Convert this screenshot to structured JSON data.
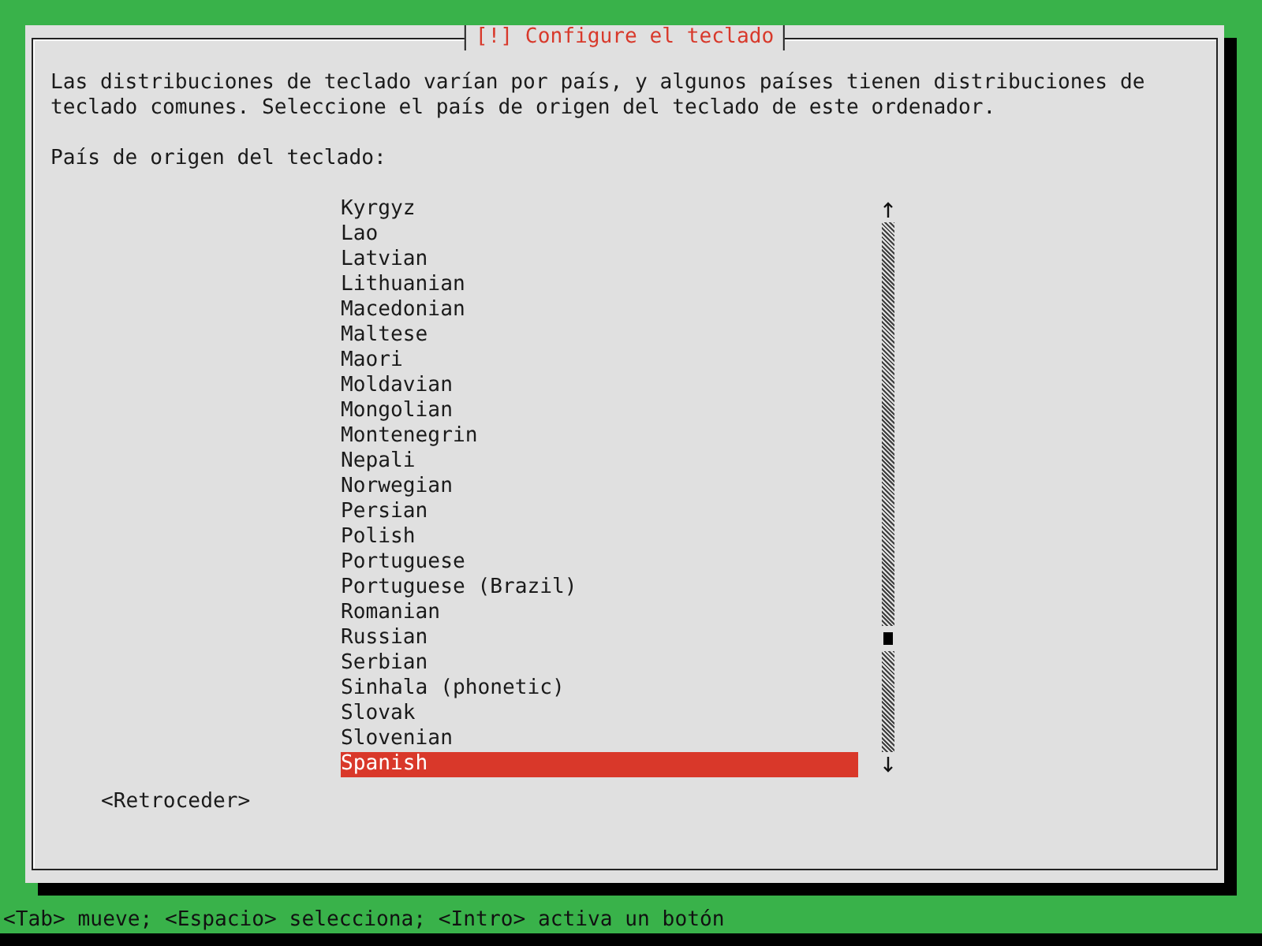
{
  "dialog": {
    "title": "[!] Configure el teclado",
    "description": "Las distribuciones de teclado varían por país, y algunos países tienen distribuciones de teclado comunes. Seleccione el país de origen del teclado de este ordenador.",
    "list_label": "País de origen del teclado:",
    "items": [
      {
        "label": "Kyrgyz",
        "selected": false
      },
      {
        "label": "Lao",
        "selected": false
      },
      {
        "label": "Latvian",
        "selected": false
      },
      {
        "label": "Lithuanian",
        "selected": false
      },
      {
        "label": "Macedonian",
        "selected": false
      },
      {
        "label": "Maltese",
        "selected": false
      },
      {
        "label": "Maori",
        "selected": false
      },
      {
        "label": "Moldavian",
        "selected": false
      },
      {
        "label": "Mongolian",
        "selected": false
      },
      {
        "label": "Montenegrin",
        "selected": false
      },
      {
        "label": "Nepali",
        "selected": false
      },
      {
        "label": "Norwegian",
        "selected": false
      },
      {
        "label": "Persian",
        "selected": false
      },
      {
        "label": "Polish",
        "selected": false
      },
      {
        "label": "Portuguese",
        "selected": false
      },
      {
        "label": "Portuguese (Brazil)",
        "selected": false
      },
      {
        "label": "Romanian",
        "selected": false
      },
      {
        "label": "Russian",
        "selected": false
      },
      {
        "label": "Serbian",
        "selected": false
      },
      {
        "label": "Sinhala (phonetic)",
        "selected": false
      },
      {
        "label": "Slovak",
        "selected": false
      },
      {
        "label": "Slovenian",
        "selected": false
      },
      {
        "label": "Spanish",
        "selected": true
      }
    ],
    "back_button": "<Retroceder>"
  },
  "status_bar": "<Tab> mueve; <Espacio> selecciona; <Intro> activa un botón"
}
